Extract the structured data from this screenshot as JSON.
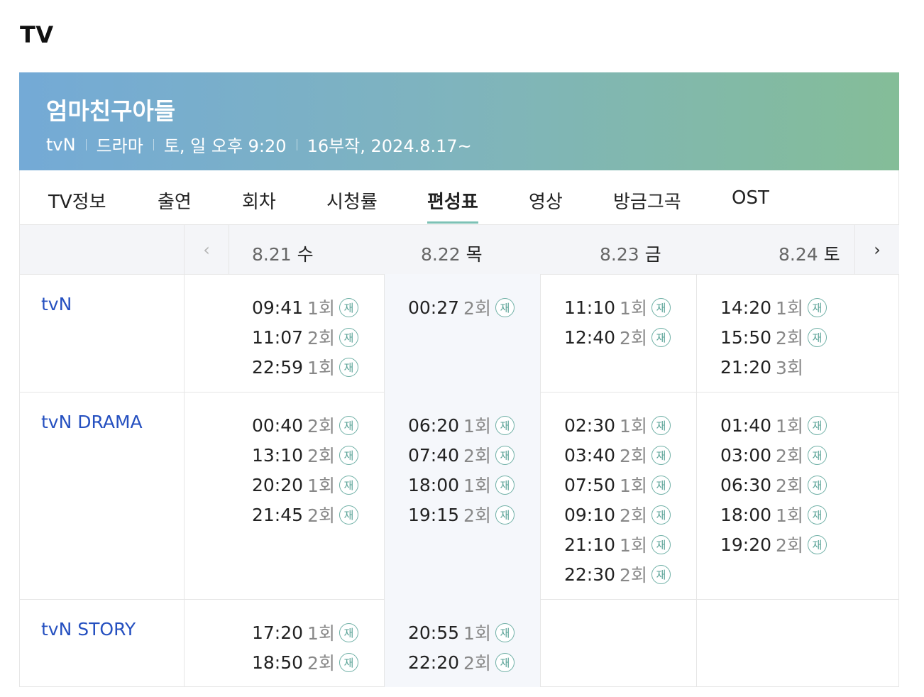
{
  "section_title": "TV",
  "program": {
    "title": "엄마친구아들",
    "meta": [
      "tvN",
      "드라마",
      "토, 일 오후 9:20",
      "16부작, 2024.8.17~"
    ]
  },
  "tabs": [
    "TV정보",
    "출연",
    "회차",
    "시청률",
    "편성표",
    "영상",
    "방금그곡",
    "OST"
  ],
  "active_tab": "편성표",
  "nav": {
    "prev": "‹",
    "next": "›"
  },
  "dates": [
    {
      "date": "8.21",
      "weekday": "수"
    },
    {
      "date": "8.22",
      "weekday": "목"
    },
    {
      "date": "8.23",
      "weekday": "금"
    },
    {
      "date": "8.24",
      "weekday": "토"
    }
  ],
  "rerun_badge": "재",
  "channels": [
    {
      "name": "tvN",
      "days": [
        [
          {
            "time": "09:41",
            "ep": "1회",
            "rerun": true
          },
          {
            "time": "11:07",
            "ep": "2회",
            "rerun": true
          },
          {
            "time": "22:59",
            "ep": "1회",
            "rerun": true
          }
        ],
        [
          {
            "time": "00:27",
            "ep": "2회",
            "rerun": true
          }
        ],
        [
          {
            "time": "11:10",
            "ep": "1회",
            "rerun": true
          },
          {
            "time": "12:40",
            "ep": "2회",
            "rerun": true
          }
        ],
        [
          {
            "time": "14:20",
            "ep": "1회",
            "rerun": true
          },
          {
            "time": "15:50",
            "ep": "2회",
            "rerun": true
          },
          {
            "time": "21:20",
            "ep": "3회",
            "rerun": false
          }
        ]
      ]
    },
    {
      "name": "tvN DRAMA",
      "days": [
        [
          {
            "time": "00:40",
            "ep": "2회",
            "rerun": true
          },
          {
            "time": "13:10",
            "ep": "2회",
            "rerun": true
          },
          {
            "time": "20:20",
            "ep": "1회",
            "rerun": true
          },
          {
            "time": "21:45",
            "ep": "2회",
            "rerun": true
          }
        ],
        [
          {
            "time": "06:20",
            "ep": "1회",
            "rerun": true
          },
          {
            "time": "07:40",
            "ep": "2회",
            "rerun": true
          },
          {
            "time": "18:00",
            "ep": "1회",
            "rerun": true
          },
          {
            "time": "19:15",
            "ep": "2회",
            "rerun": true
          }
        ],
        [
          {
            "time": "02:30",
            "ep": "1회",
            "rerun": true
          },
          {
            "time": "03:40",
            "ep": "2회",
            "rerun": true
          },
          {
            "time": "07:50",
            "ep": "1회",
            "rerun": true
          },
          {
            "time": "09:10",
            "ep": "2회",
            "rerun": true
          },
          {
            "time": "21:10",
            "ep": "1회",
            "rerun": true
          },
          {
            "time": "22:30",
            "ep": "2회",
            "rerun": true
          }
        ],
        [
          {
            "time": "01:40",
            "ep": "1회",
            "rerun": true
          },
          {
            "time": "03:00",
            "ep": "2회",
            "rerun": true
          },
          {
            "time": "06:30",
            "ep": "2회",
            "rerun": true
          },
          {
            "time": "18:00",
            "ep": "1회",
            "rerun": true
          },
          {
            "time": "19:20",
            "ep": "2회",
            "rerun": true
          }
        ]
      ]
    },
    {
      "name": "tvN STORY",
      "days": [
        [
          {
            "time": "17:20",
            "ep": "1회",
            "rerun": true
          },
          {
            "time": "18:50",
            "ep": "2회",
            "rerun": true
          }
        ],
        [
          {
            "time": "20:55",
            "ep": "1회",
            "rerun": true
          },
          {
            "time": "22:20",
            "ep": "2회",
            "rerun": true
          }
        ],
        [],
        []
      ]
    }
  ]
}
